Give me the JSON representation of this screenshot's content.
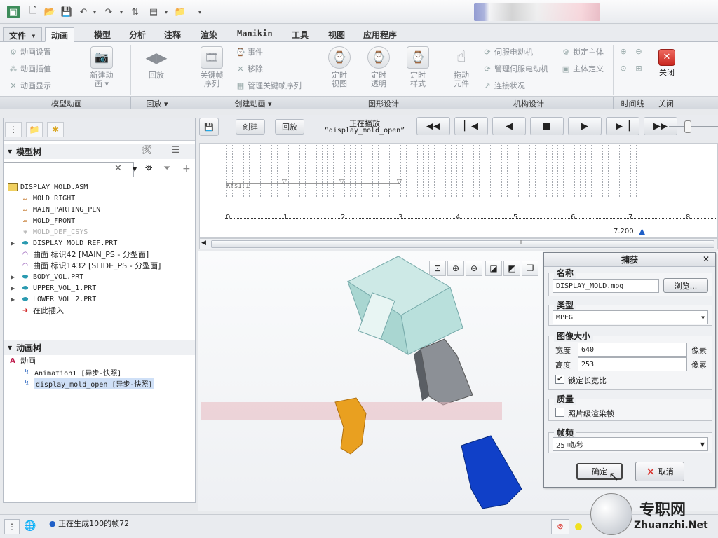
{
  "ribbon_tabs": [
    "文件",
    "动画",
    "模型",
    "分析",
    "注释",
    "渲染",
    "Manikin",
    "工具",
    "视图",
    "应用程序"
  ],
  "ribbon": {
    "anim_settings": "动画设置",
    "anim_interp": "动画插值",
    "anim_display": "动画显示",
    "new_anim_l1": "新建动",
    "new_anim_l2": "画",
    "playback": "回放",
    "keyframe_l1": "关键帧",
    "keyframe_l2": "序列",
    "event": "事件",
    "remove": "移除",
    "manage_kf": "管理关键帧序列",
    "timed_view_l1": "定时",
    "timed_view_l2": "视图",
    "timed_trans_l1": "定时",
    "timed_trans_l2": "透明",
    "timed_style_l1": "定时",
    "timed_style_l2": "样式",
    "drag_l1": "拖动",
    "drag_l2": "元件",
    "servo": "伺服电动机",
    "manage_servo": "管理伺服电动机",
    "conn_status": "连接状况",
    "lock_body": "锁定主体",
    "body_def": "主体定义",
    "close": "关闭"
  },
  "groups": [
    "模型动画",
    "回放",
    "创建动画",
    "图形设计",
    "机构设计",
    "时间线",
    "关闭"
  ],
  "playback_bar": {
    "create": "创建",
    "playback": "回放",
    "now_playing": "正在播放",
    "anim_name": "“display_mold_open”"
  },
  "model_tree": {
    "title": "模型树",
    "items": [
      "DISPLAY_MOLD.ASM",
      "MOLD_RIGHT",
      "MAIN_PARTING_PLN",
      "MOLD_FRONT",
      "MOLD_DEF_CSYS",
      "DISPLAY_MOLD_REF.PRT",
      "曲面 标识42 [MAIN_PS - 分型面]",
      "曲面 标识1432 [SLIDE_PS - 分型面]",
      "BODY_VOL.PRT",
      "UPPER_VOL_1.PRT",
      "LOWER_VOL_2.PRT",
      "在此插入"
    ]
  },
  "anim_tree": {
    "title": "动画树",
    "root": "动画",
    "items": [
      "Animation1 [异步-快照]",
      "display_mold_open [异步-快照]"
    ]
  },
  "timeline": {
    "kfs_label": "Kfs1.1",
    "ticks": [
      "0",
      "1",
      "2",
      "3",
      "4",
      "5",
      "6",
      "7",
      "8"
    ],
    "current_time": "7.200"
  },
  "dialog": {
    "title": "捕获",
    "name_label": "名称",
    "name_value": "DISPLAY_MOLD.mpg",
    "browse": "浏览...",
    "type_label": "类型",
    "type_value": "MPEG",
    "size_label": "图像大小",
    "width_label": "宽度",
    "width_value": "640",
    "height_label": "高度",
    "height_value": "253",
    "px1": "像素",
    "px2": "像素",
    "lock_aspect": "锁定长宽比",
    "quality_label": "质量",
    "photo_render": "照片级渲染帧",
    "fps_label": "帧频",
    "fps_value": "25 帧/秒",
    "ok": "确定",
    "cancel": "取消"
  },
  "status": {
    "message": "正在生成100的帧72"
  },
  "watermark": {
    "cn": "专职网",
    "en": "Zhuanzhi.Net"
  },
  "colors": {
    "accent": "#1f5fc7",
    "close_red": "#d9302a",
    "mold_cyan": "#b9e0dc",
    "blue_part": "#1040c8",
    "orange_part": "#e9a020"
  }
}
